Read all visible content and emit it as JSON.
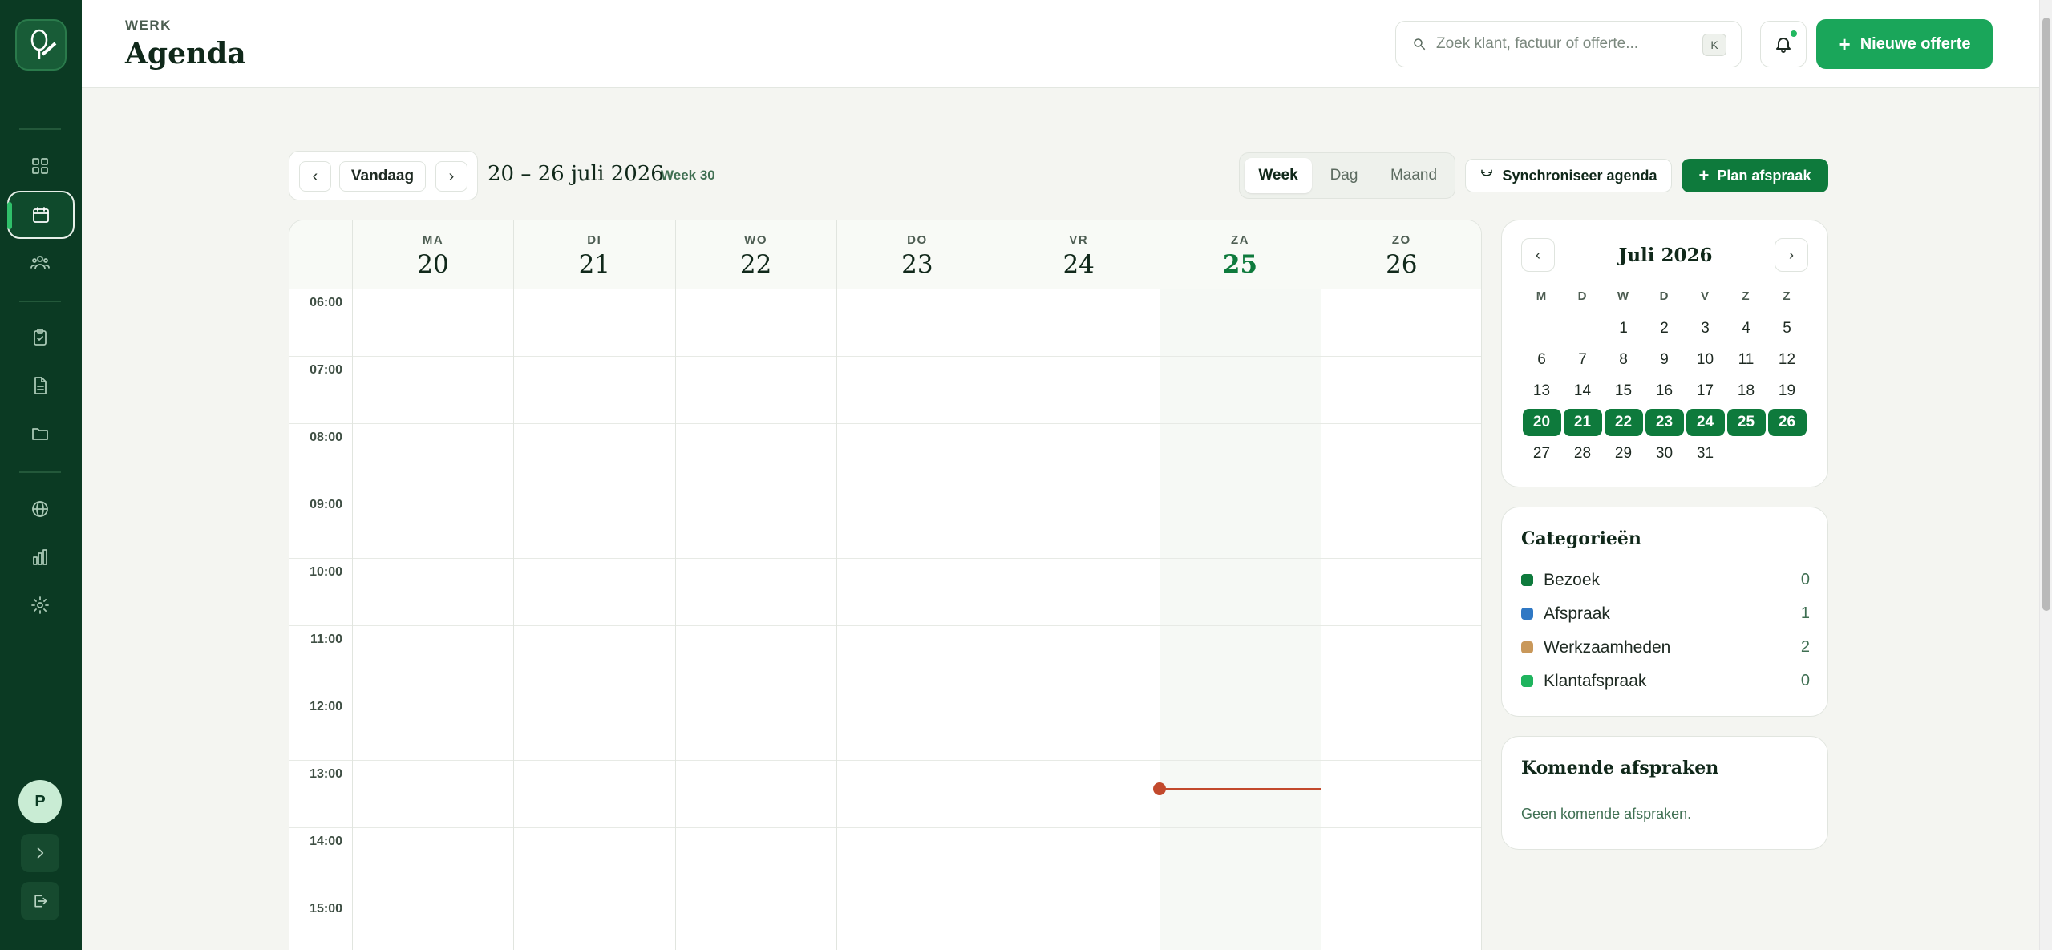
{
  "header": {
    "eyebrow": "WERK",
    "title": "Agenda",
    "search_placeholder": "Zoek klant, factuur of offerte...",
    "search_value": "",
    "shortcut": "K",
    "new_quote_label": "Nieuwe offerte"
  },
  "sidebar": {
    "items": [
      {
        "icon": "dashboard-grid-icon"
      },
      {
        "icon": "calendar-icon",
        "active": true
      },
      {
        "icon": "users-icon"
      },
      {
        "icon": "clipboard-check-icon"
      },
      {
        "icon": "document-icon"
      },
      {
        "icon": "folder-icon"
      },
      {
        "icon": "globe-icon"
      },
      {
        "icon": "bar-chart-icon"
      },
      {
        "icon": "gear-icon"
      }
    ],
    "avatar_initial": "P"
  },
  "toolbar": {
    "today_label": "Vandaag",
    "range": "20 – 26 juli 2026",
    "week": "Week 30",
    "views": [
      {
        "label": "Week",
        "active": true
      },
      {
        "label": "Dag",
        "active": false
      },
      {
        "label": "Maand",
        "active": false
      }
    ],
    "sync_label": "Synchroniseer agenda",
    "plan_label": "Plan afspraak"
  },
  "calendar": {
    "days": [
      {
        "abbr": "MA",
        "num": "20"
      },
      {
        "abbr": "DI",
        "num": "21"
      },
      {
        "abbr": "WO",
        "num": "22"
      },
      {
        "abbr": "DO",
        "num": "23"
      },
      {
        "abbr": "VR",
        "num": "24"
      },
      {
        "abbr": "ZA",
        "num": "25",
        "today": true
      },
      {
        "abbr": "ZO",
        "num": "26"
      }
    ],
    "hours": [
      "06:00",
      "07:00",
      "08:00",
      "09:00",
      "10:00",
      "11:00",
      "12:00",
      "13:00",
      "14:00",
      "15:00"
    ],
    "now_time": "13:25",
    "accent": "#0e7a3c",
    "now_color": "#c2492c"
  },
  "mini_calendar": {
    "title": "Juli 2026",
    "dow": [
      "M",
      "D",
      "W",
      "D",
      "V",
      "Z",
      "Z"
    ],
    "weeks": [
      [
        "",
        "",
        "1",
        "2",
        "3",
        "4",
        "5"
      ],
      [
        "6",
        "7",
        "8",
        "9",
        "10",
        "11",
        "12"
      ],
      [
        "13",
        "14",
        "15",
        "16",
        "17",
        "18",
        "19"
      ],
      [
        "20",
        "21",
        "22",
        "23",
        "24",
        "25",
        "26"
      ],
      [
        "27",
        "28",
        "29",
        "30",
        "31",
        "",
        ""
      ]
    ],
    "selected_week": 3
  },
  "categories": {
    "title": "Categorieën",
    "items": [
      {
        "name": "Bezoek",
        "count": "0",
        "color": "#0e7a3c"
      },
      {
        "name": "Afspraak",
        "count": "1",
        "color": "#2f78c4"
      },
      {
        "name": "Werkzaamheden",
        "count": "2",
        "color": "#c9985a"
      },
      {
        "name": "Klantafspraak",
        "count": "0",
        "color": "#1fb45e"
      }
    ]
  },
  "upcoming": {
    "title": "Komende afspraken",
    "empty": "Geen komende afspraken."
  }
}
